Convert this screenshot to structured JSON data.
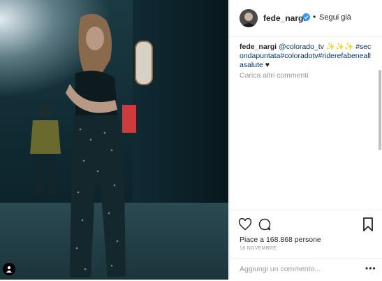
{
  "post": {
    "username": "fede_nargi",
    "follow_separator": "•",
    "follow_label": "Segui già",
    "caption": {
      "user": "fede_nargi",
      "mention": "@colorado_tv",
      "emoji": "✨✨✨",
      "hashtags": "#secondapuntata#coloradotv#riderefabeneallasalute",
      "trailing": "♥"
    },
    "load_more": "Carica altri commenti",
    "likes": "Piace a 168.868 persone",
    "date": "18 NOVEMBRE",
    "add_comment_placeholder": "Aggiungi un commento...",
    "more_label": "•••"
  },
  "icons": {
    "heart": "heart-icon",
    "comment": "comment-icon",
    "bookmark": "bookmark-icon",
    "verified": "verified-badge-icon",
    "user_tag": "user-tag-icon"
  },
  "colors": {
    "verified": "#3897f0",
    "hashtag": "#003569",
    "muted": "#999999",
    "text": "#262626"
  }
}
